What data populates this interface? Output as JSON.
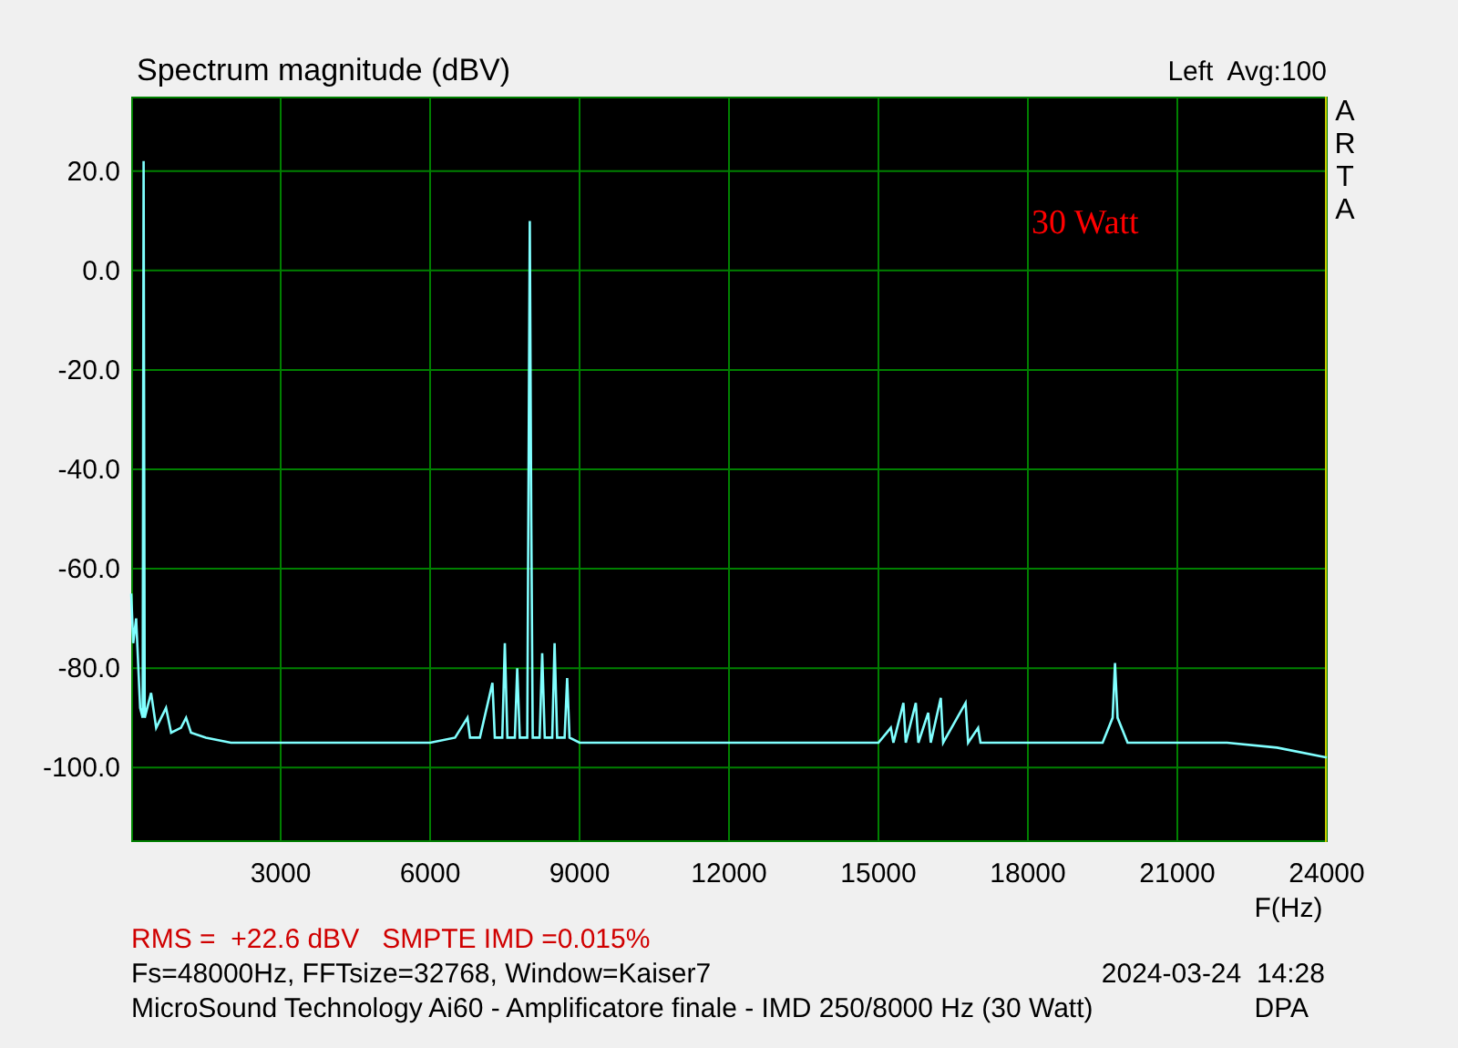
{
  "chart": {
    "channel_info": "Left  Avg:100",
    "side_label": "ARTA",
    "chart_data": {
      "type": "line",
      "title": "Spectrum magnitude (dBV)",
      "xlabel": "F(Hz)",
      "xlim": [
        0,
        24000
      ],
      "ylim": [
        -115,
        35
      ],
      "xticks": [
        3000,
        6000,
        9000,
        12000,
        15000,
        18000,
        21000,
        24000
      ],
      "yticks": [
        {
          "value": 20,
          "label": "20.0"
        },
        {
          "value": 0,
          "label": "0.0"
        },
        {
          "value": -20,
          "label": "-20.0"
        },
        {
          "value": -40,
          "label": "-40.0"
        },
        {
          "value": -60,
          "label": "-60.0"
        },
        {
          "value": -80,
          "label": "-80.0"
        },
        {
          "value": -100,
          "label": "-100.0"
        }
      ],
      "x": [
        0,
        40,
        100,
        180,
        230,
        250,
        270,
        400,
        500,
        700,
        800,
        1000,
        1100,
        1200,
        1500,
        2000,
        3000,
        4000,
        5000,
        6000,
        6500,
        6750,
        6800,
        7000,
        7250,
        7300,
        7450,
        7500,
        7550,
        7700,
        7750,
        7800,
        7950,
        8000,
        8030,
        8060,
        8200,
        8250,
        8300,
        8450,
        8500,
        8550,
        8700,
        8750,
        8800,
        9000,
        10000,
        12000,
        15000,
        15250,
        15300,
        15500,
        15550,
        15750,
        15800,
        16000,
        16050,
        16250,
        16300,
        16750,
        16800,
        17000,
        17050,
        19500,
        19700,
        19750,
        19800,
        20000,
        22000,
        23000,
        24000
      ],
      "grid": true,
      "series": [
        {
          "color": "#80ffff",
          "values": [
            -65,
            -75,
            -70,
            -88,
            -90,
            22,
            -90,
            -85,
            -92,
            -88,
            -93,
            -92,
            -90,
            -93,
            -94,
            -95,
            -95,
            -95,
            -95,
            -95,
            -94,
            -90,
            -94,
            -94,
            -83,
            -94,
            -94,
            -75,
            -94,
            -94,
            -80,
            -94,
            -94,
            10,
            -50,
            -94,
            -94,
            -77,
            -94,
            -94,
            -75,
            -94,
            -94,
            -82,
            -94,
            -95,
            -95,
            -95,
            -95,
            -92,
            -95,
            -87,
            -95,
            -87,
            -95,
            -89,
            -95,
            -86,
            -95,
            -87,
            -95,
            -92,
            -95,
            -95,
            -90,
            -79,
            -90,
            -95,
            -95,
            -96,
            -98
          ]
        }
      ],
      "annotations": [
        "30 Watt"
      ]
    }
  },
  "readouts": {
    "measurement": "RMS =  +22.6 dBV   SMPTE IMD =0.015%",
    "settings": "Fs=48000Hz, FFTsize=32768, Window=Kaiser7",
    "timestamp": "2024-03-24  14:28",
    "description": "MicroSound Technology Ai60 - Amplificatore finale - IMD 250/8000 Hz (30 Watt)",
    "tag": "DPA"
  }
}
